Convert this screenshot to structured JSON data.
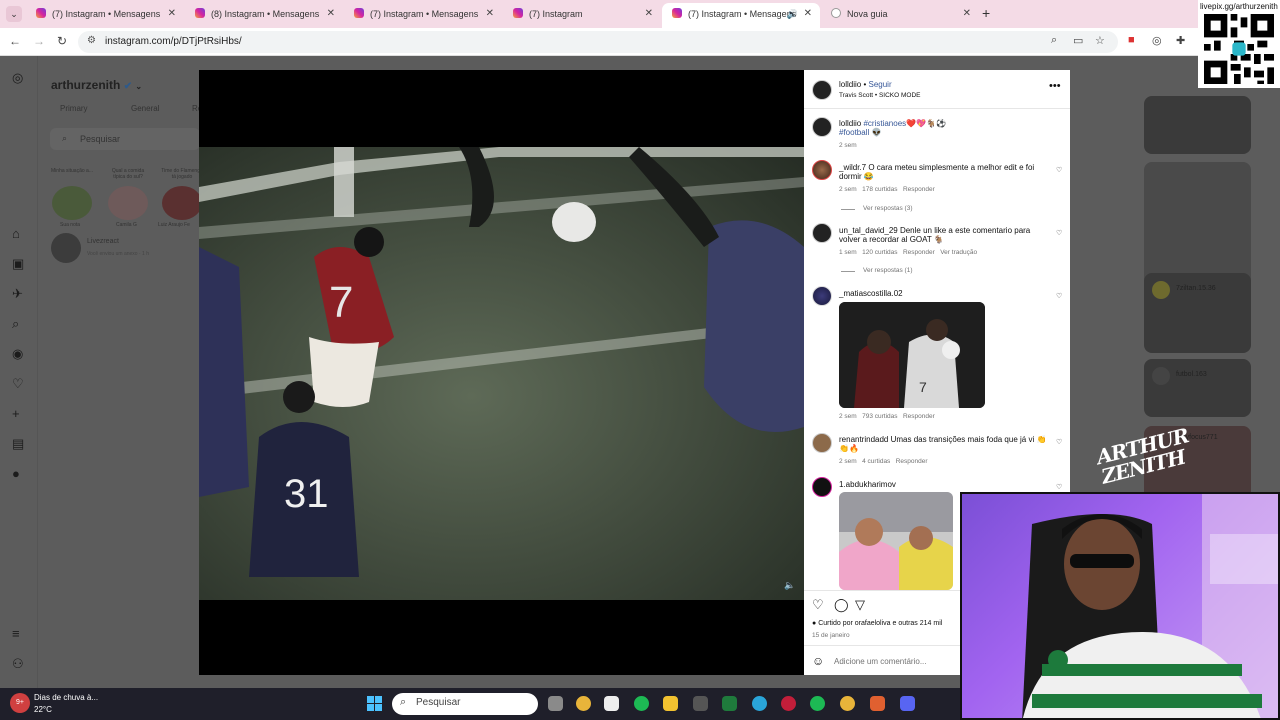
{
  "browser": {
    "tabs": [
      {
        "label": "(7) Instagram • Mensagens"
      },
      {
        "label": "(8) Instagram • Mensagens"
      },
      {
        "label": "(7) Instagram • Mensagens"
      },
      {
        "label": "(7) Instagram"
      },
      {
        "label": "(7) Instagram • Mensagens"
      },
      {
        "label": "Nova guia"
      }
    ],
    "url": "instagram.com/p/DTjPtRsiHbs/"
  },
  "dm": {
    "username": "arthurzenith",
    "tabs": [
      "Primary",
      "General",
      "Re"
    ],
    "search_placeholder": "Pesquisar",
    "notes": [
      {
        "text": "Minha situação a...",
        "name": "Sua nota"
      },
      {
        "text": "Qual a comida típica do sul?",
        "name": "Camila G"
      },
      {
        "text": "Time do Flamengo tá jogado",
        "name": "Luiz Araujo Fe"
      }
    ],
    "thread": {
      "name": "Livezreact",
      "preview": "Você enviou um anexo · 1 h"
    }
  },
  "right_feed": [
    {
      "name": "7ziltan.15.36"
    },
    {
      "name": "futbol.163"
    },
    {
      "name": "footyfocus771"
    }
  ],
  "post": {
    "author": "lolldiio",
    "follow": "Seguir",
    "audio": "Travis Scott • SICKO MODE",
    "caption_user": "lolldiio",
    "caption_tags": "#cristianoes",
    "caption_tag2": "#football",
    "caption_emojis": "❤️💖🐐⚽",
    "caption_emoji2": "👽",
    "caption_time": "2 sem",
    "comments": [
      {
        "user": "_wildr.7",
        "text": "O cara meteu simplesmente a melhor edit e foi dormir 😂",
        "time": "2 sem",
        "likes": "178 curtidas",
        "reply": "Responder",
        "replies": "Ver respostas (3)"
      },
      {
        "user": "un_tal_david_29",
        "text": "Denle un like a este comentario para volver a recordar al GOAT 🐐",
        "time": "1 sem",
        "likes": "120 curtidas",
        "reply": "Responder",
        "translate": "Ver tradução",
        "replies": "Ver respostas (1)"
      },
      {
        "user": "_matiascostilla.02",
        "time": "2 sem",
        "likes": "793 curtidas",
        "reply": "Responder"
      },
      {
        "user": "renantrindadd",
        "text": "Umas das transições mais foda que já vi 👏👏🔥",
        "time": "2 sem",
        "likes": "4 curtidas",
        "reply": "Responder"
      },
      {
        "user": "1.abdukharimov"
      }
    ],
    "liked_by": "Curtido por orafaeloliva e outras 214 mil",
    "date": "15 de janeiro",
    "add_comment": "Adicione um comentário..."
  },
  "taskbar": {
    "weather_title": "Dias de chuva à...",
    "weather_temp": "22°C",
    "search_placeholder": "Pesquisar",
    "badge": "9+"
  },
  "overlay": {
    "qr_text": "livepix.gg/arthurzenith",
    "logo_line1": "ARTHUR",
    "logo_line2": "ZENITH"
  },
  "colors": {
    "accent": "#385898",
    "tabbar": "#f4dbe6",
    "taskbar": "#1f1f2a",
    "cam_bg": "#a264f0"
  }
}
